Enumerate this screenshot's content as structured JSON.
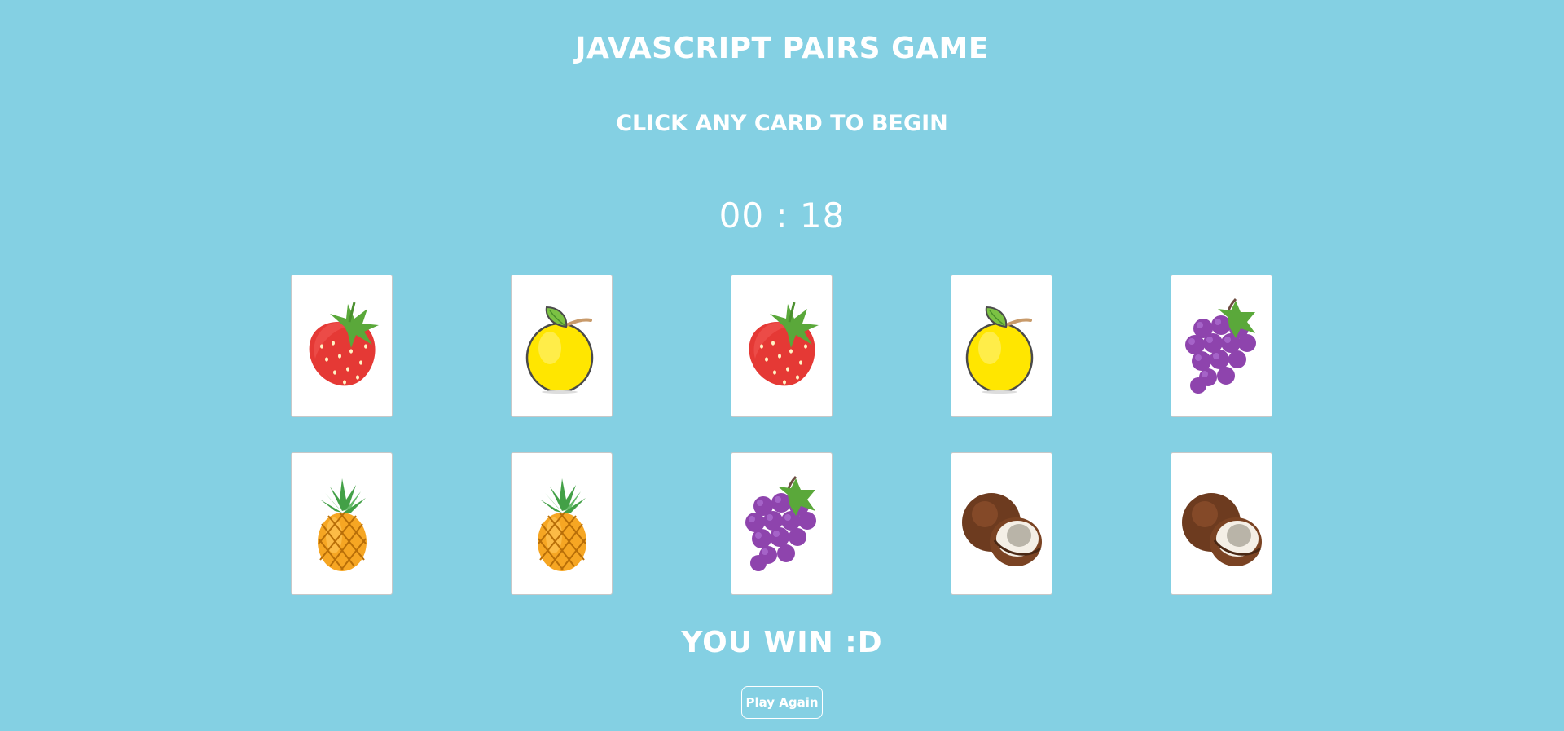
{
  "game": {
    "title": "JAVASCRIPT PAIRS GAME",
    "instruction": "CLICK ANY CARD TO BEGIN",
    "timer": "00 : 18",
    "win_message": "YOU WIN :D",
    "play_again_label": "Play Again"
  },
  "theme": {
    "background": "#84d0e3",
    "text": "#ffffff",
    "card_face": "#ffffff"
  },
  "cards": [
    {
      "fruit": "strawberry",
      "icon": "strawberry-icon",
      "state": "revealed"
    },
    {
      "fruit": "lemon",
      "icon": "lemon-icon",
      "state": "revealed"
    },
    {
      "fruit": "strawberry",
      "icon": "strawberry-icon",
      "state": "revealed"
    },
    {
      "fruit": "lemon",
      "icon": "lemon-icon",
      "state": "revealed"
    },
    {
      "fruit": "grapes",
      "icon": "grapes-icon",
      "state": "revealed"
    },
    {
      "fruit": "pineapple",
      "icon": "pineapple-icon",
      "state": "revealed"
    },
    {
      "fruit": "pineapple",
      "icon": "pineapple-icon",
      "state": "revealed"
    },
    {
      "fruit": "grapes",
      "icon": "grapes-icon",
      "state": "revealed"
    },
    {
      "fruit": "coconut",
      "icon": "coconut-icon",
      "state": "revealed"
    },
    {
      "fruit": "coconut",
      "icon": "coconut-icon",
      "state": "revealed"
    }
  ]
}
